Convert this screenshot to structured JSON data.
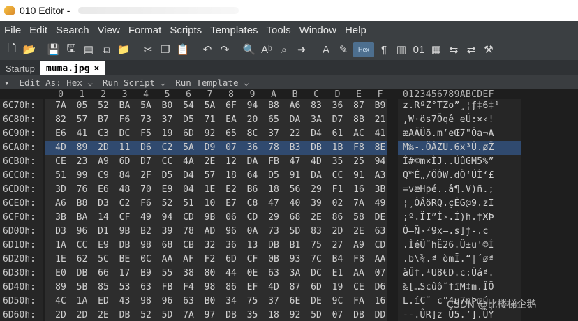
{
  "app": {
    "title": "010 Editor -"
  },
  "menu": [
    "File",
    "Edit",
    "Search",
    "View",
    "Format",
    "Scripts",
    "Templates",
    "Tools",
    "Window",
    "Help"
  ],
  "toolbar_icons": [
    "new-file-icon",
    "open-folder-icon",
    "save-icon",
    "save-as-icon",
    "save-all-icon",
    "copy-file-icon",
    "folder-icon",
    "cut-icon",
    "copy-icon",
    "paste-icon",
    "undo-icon",
    "redo-icon",
    "find-icon",
    "replace-icon",
    "find-in-files-icon",
    "goto-icon",
    "font-icon",
    "highlight-icon",
    "hex-mode-icon",
    "paragraph-icon",
    "columns-icon",
    "binary-icon",
    "calculator-icon",
    "compare-icon",
    "convert-icon",
    "tools-icon"
  ],
  "tabs": [
    {
      "label": "Startup"
    },
    {
      "label": "muma.jpg"
    }
  ],
  "subbar": {
    "edit_as": "Edit As: Hex ⌵",
    "run_script": "Run Script ⌵",
    "run_template": "Run Template ⌵"
  },
  "columns": [
    "0",
    "1",
    "2",
    "3",
    "4",
    "5",
    "6",
    "7",
    "8",
    "9",
    "A",
    "B",
    "C",
    "D",
    "E",
    "F"
  ],
  "ascii_header": "0123456789ABCDEF",
  "rows": [
    {
      "offset": "6C70h:",
      "bytes": [
        "7A",
        "05",
        "52",
        "BA",
        "5A",
        "B0",
        "54",
        "5A",
        "6F",
        "94",
        "B8",
        "A6",
        "83",
        "36",
        "87",
        "B9"
      ],
      "ascii": "z.RºZ°TZo”¸¦ƒ‡6‡¹"
    },
    {
      "offset": "6C80h:",
      "bytes": [
        "82",
        "57",
        "B7",
        "F6",
        "73",
        "37",
        "D5",
        "71",
        "EA",
        "20",
        "65",
        "DA",
        "3A",
        "D7",
        "8B",
        "21"
      ],
      "ascii": "‚W·ös7Õqê eÚ:×‹!"
    },
    {
      "offset": "6C90h:",
      "bytes": [
        "E6",
        "41",
        "C3",
        "DC",
        "F5",
        "19",
        "6D",
        "92",
        "65",
        "8C",
        "37",
        "22",
        "D4",
        "61",
        "AC",
        "41"
      ],
      "ascii": "æAÃÜõ.m’eŒ7\"Ôa¬A"
    },
    {
      "offset": "6CA0h:",
      "bytes": [
        "4D",
        "89",
        "2D",
        "11",
        "D6",
        "C2",
        "5A",
        "D9",
        "07",
        "36",
        "78",
        "B3",
        "DB",
        "1B",
        "F8",
        "8E"
      ],
      "ascii": "M‰-.ÖÂZÙ.6x³Û.øŽ",
      "highlight": true
    },
    {
      "offset": "6CB0h:",
      "bytes": [
        "CE",
        "23",
        "A9",
        "6D",
        "D7",
        "CC",
        "4A",
        "2E",
        "12",
        "DA",
        "FB",
        "47",
        "4D",
        "35",
        "25",
        "94"
      ],
      "ascii": "Î#©m×ÌJ..ÚûGM5%”"
    },
    {
      "offset": "6CC0h:",
      "bytes": [
        "51",
        "99",
        "C9",
        "84",
        "2F",
        "D5",
        "D4",
        "57",
        "18",
        "64",
        "D5",
        "91",
        "DA",
        "CC",
        "91",
        "A3"
      ],
      "ascii": "Q™É„/ÕÔW.dÕ‘ÚÌ‘£"
    },
    {
      "offset": "6CD0h:",
      "bytes": [
        "3D",
        "76",
        "E6",
        "48",
        "70",
        "E9",
        "04",
        "1E",
        "E2",
        "B6",
        "18",
        "56",
        "29",
        "F1",
        "16",
        "3B"
      ],
      "ascii": "=væHpé..â¶.V)ñ.;"
    },
    {
      "offset": "6CE0h:",
      "bytes": [
        "A6",
        "B8",
        "D3",
        "C2",
        "F6",
        "52",
        "51",
        "10",
        "E7",
        "C8",
        "47",
        "40",
        "39",
        "02",
        "7A",
        "49"
      ],
      "ascii": "¦¸ÓÂöRQ.çÈG@9.zI"
    },
    {
      "offset": "6CF0h:",
      "bytes": [
        "3B",
        "BA",
        "14",
        "CF",
        "49",
        "94",
        "CD",
        "9B",
        "06",
        "CD",
        "29",
        "68",
        "2E",
        "86",
        "58",
        "DE"
      ],
      "ascii": ";º.ÏI”Í›.Í)h.†XÞ"
    },
    {
      "offset": "6D00h:",
      "bytes": [
        "D3",
        "96",
        "D1",
        "9B",
        "B2",
        "39",
        "78",
        "AD",
        "96",
        "0A",
        "73",
        "5D",
        "83",
        "2D",
        "2E",
        "63"
      ],
      "ascii": "Ó–Ñ›²9x­–.s]ƒ-.c"
    },
    {
      "offset": "6D10h:",
      "bytes": [
        "1A",
        "CC",
        "E9",
        "DB",
        "98",
        "68",
        "CB",
        "32",
        "36",
        "13",
        "DB",
        "B1",
        "75",
        "27",
        "A9",
        "CD"
      ],
      "ascii": ".ÌéÛ˜hË26.Û±u'©Í"
    },
    {
      "offset": "6D20h:",
      "bytes": [
        "1E",
        "62",
        "5C",
        "BE",
        "0C",
        "AA",
        "AF",
        "F2",
        "6D",
        "CF",
        "0B",
        "93",
        "7C",
        "B4",
        "F8",
        "AA"
      ],
      "ascii": ".b\\¾.ª¯òmÏ.“|´øª"
    },
    {
      "offset": "6D30h:",
      "bytes": [
        "E0",
        "DB",
        "66",
        "17",
        "B9",
        "55",
        "38",
        "80",
        "44",
        "0E",
        "63",
        "3A",
        "DC",
        "E1",
        "AA",
        "07"
      ],
      "ascii": "àÛf.¹U8€D.c:Üáª."
    },
    {
      "offset": "6D40h:",
      "bytes": [
        "89",
        "5B",
        "85",
        "53",
        "63",
        "FB",
        "F4",
        "98",
        "86",
        "EF",
        "4D",
        "87",
        "6D",
        "19",
        "CE",
        "D6"
      ],
      "ascii": "‰[…Scûô˜†ïM‡m.ÎÖ"
    },
    {
      "offset": "6D50h:",
      "bytes": [
        "4C",
        "1A",
        "ED",
        "43",
        "98",
        "96",
        "63",
        "B0",
        "34",
        "75",
        "37",
        "6E",
        "DE",
        "9C",
        "FA",
        "16"
      ],
      "ascii": "L.íC˜–c°4u7nÞœú."
    },
    {
      "offset": "6D60h:",
      "bytes": [
        "2D",
        "2D",
        "2E",
        "DB",
        "52",
        "5D",
        "7A",
        "97",
        "DB",
        "35",
        "18",
        "92",
        "5D",
        "07",
        "DB",
        "DD"
      ],
      "ascii": "--.ÛR]z—Û5.’].ÛÝ"
    }
  ],
  "watermark": "CSDN @比楼梯企鹅"
}
